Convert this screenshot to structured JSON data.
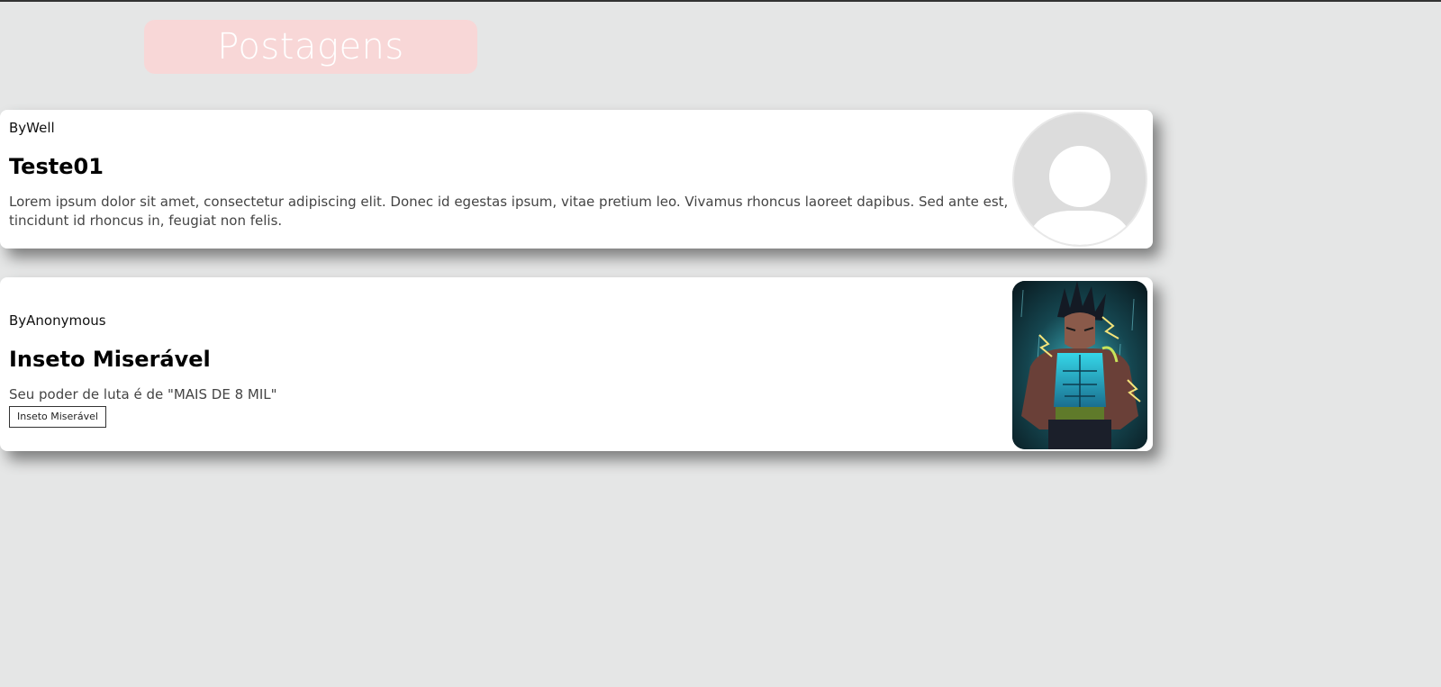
{
  "header": {
    "title": "Postagens"
  },
  "posts": [
    {
      "author": "ByWell",
      "title": "Teste01",
      "text": "Lorem ipsum dolor sit amet, consectetur adipiscing elit. Donec id egestas ipsum, vitae pretium leo. Vivamus rhoncus laoreet dapibus. Sed ante est, tincidunt id rhoncus in, feugiat non felis.",
      "image": "default-avatar-icon"
    },
    {
      "author": "ByAnonymous",
      "title": "Inseto Miserável",
      "text": "Seu poder de luta é de \"MAIS DE 8 MIL\"",
      "button_label": "Inseto Miserável",
      "image": "anime-character-image"
    }
  ],
  "colors": {
    "background": "#e5e6e6",
    "header_pill": "#f8d7d7",
    "card": "#ffffff"
  }
}
